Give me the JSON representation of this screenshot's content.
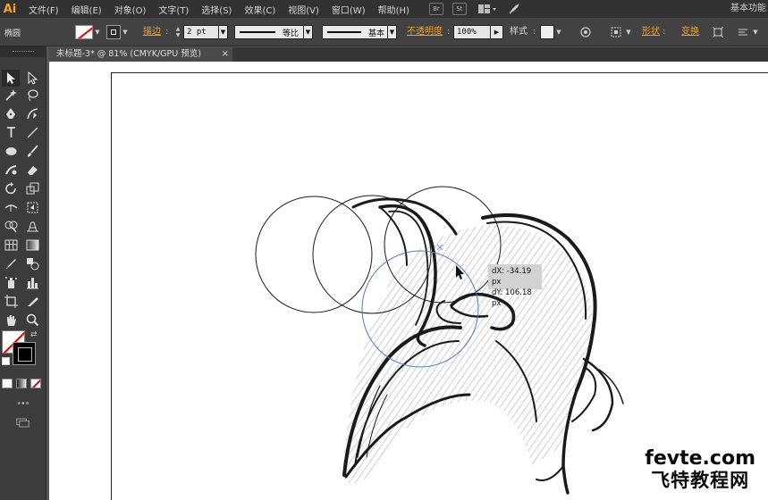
{
  "app": {
    "logo": "Ai",
    "workspace": "基本功能"
  },
  "menu": [
    "文件(F)",
    "编辑(E)",
    "对象(O)",
    "文字(T)",
    "选择(S)",
    "效果(C)",
    "视图(V)",
    "窗口(W)",
    "帮助(H)"
  ],
  "menubar_icons": [
    "bridge-icon",
    "stock-icon",
    "arrange-documents-icon",
    "gpu-rocket-icon"
  ],
  "menubar_labels": {
    "bridge": "Br",
    "stock": "St"
  },
  "control": {
    "selection_label": "椭圆",
    "stroke_label": "描边",
    "stroke_weight": "2 pt",
    "profile_label": "等比",
    "brush_label": "基本",
    "opacity_label": "不透明度",
    "opacity_value": "100%",
    "style_label": "样式",
    "shape_label": "形状",
    "transform_label": "变换"
  },
  "document": {
    "tab_title": "未标题-3* @ 81% (CMYK/GPU 预览)",
    "close_glyph": "×"
  },
  "tooltip": {
    "dx": "dX: -34.19 px",
    "dy": "dY: 106.18 px"
  },
  "watermark": {
    "line1": "fevte.com",
    "line2": "飞特教程网"
  },
  "colors": {
    "accent_orange": "#f0a030",
    "logo_orange": "#f7a41d",
    "selection_blue": "#4a78c8",
    "panel_dark": "#3c3c3c",
    "menubar": "#323232"
  }
}
